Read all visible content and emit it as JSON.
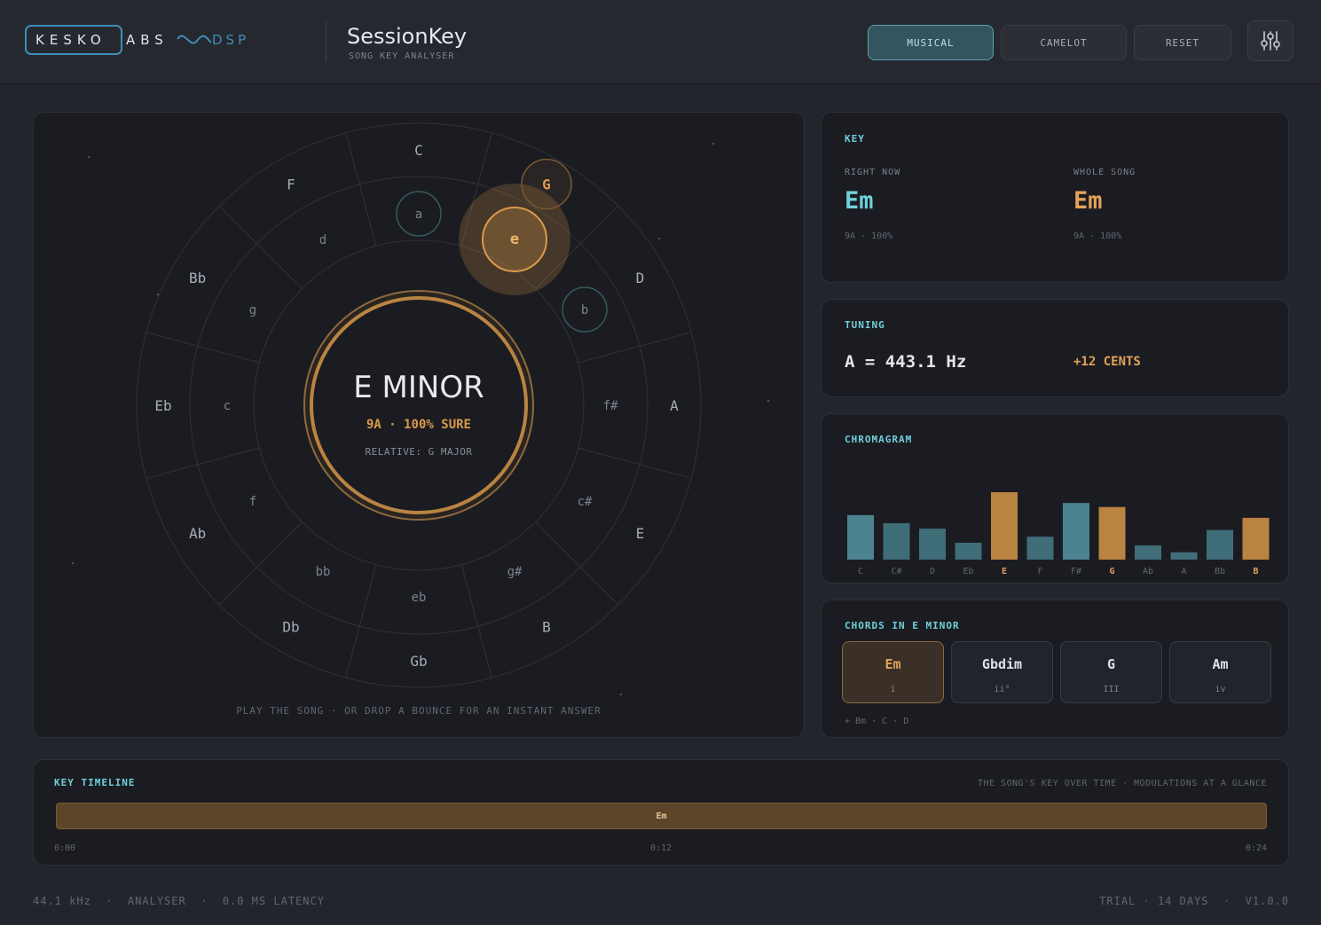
{
  "header": {
    "logo": {
      "brand_left": "KESKO",
      "brand_right": "ABS",
      "suffix": "DSP"
    },
    "title": "SessionKey",
    "subtitle": "SONG KEY ANALYSER",
    "modes": [
      {
        "label": "MUSICAL",
        "active": true
      },
      {
        "label": "CAMELOT",
        "active": false
      }
    ],
    "reset_label": "RESET",
    "settings_icon": "sliders-icon"
  },
  "wheel": {
    "major_keys": [
      "C",
      "G",
      "D",
      "A",
      "E",
      "B",
      "Gb",
      "Db",
      "Ab",
      "Eb",
      "Bb",
      "F"
    ],
    "minor_keys": [
      "a",
      "e",
      "b",
      "f#",
      "c#",
      "g#",
      "eb",
      "bb",
      "f",
      "c",
      "g",
      "d"
    ],
    "current_index": 1,
    "current_ring": "minor",
    "secondary_minor": [
      "a",
      "b"
    ],
    "secondary_major": [
      "G"
    ],
    "center": {
      "name": "E MINOR",
      "sure": "9A · 100% SURE",
      "relative": "RELATIVE: G MAJOR"
    },
    "hint": "PLAY THE SONG · OR DROP A BOUNCE FOR AN INSTANT ANSWER",
    "accent": "#d99a4b"
  },
  "key_panel": {
    "title": "KEY",
    "right_now": {
      "label": "RIGHT NOW",
      "value": "Em",
      "sub": "9A · 100%",
      "color": "#6fd0dc"
    },
    "whole_song": {
      "label": "WHOLE SONG",
      "value": "Em",
      "sub": "9A · 100%",
      "color": "#e2a15a"
    }
  },
  "tuning_panel": {
    "title": "TUNING",
    "value": "A = 443.1 Hz",
    "cents": "+12 CENTS"
  },
  "chromagram": {
    "title": "CHROMAGRAM",
    "notes": [
      "C",
      "C#",
      "D",
      "Eb",
      "E",
      "F",
      "F#",
      "G",
      "Ab",
      "A",
      "Bb",
      "B"
    ],
    "levels": [
      0.66,
      0.54,
      0.46,
      0.25,
      1.0,
      0.34,
      0.84,
      0.78,
      0.21,
      0.11,
      0.44,
      0.62
    ],
    "in_key": [
      false,
      false,
      false,
      false,
      true,
      false,
      false,
      true,
      false,
      false,
      false,
      true
    ],
    "colors": {
      "normal": "#3f6d78",
      "highlight": "#4b8490",
      "key": "#b98342"
    }
  },
  "chords_panel": {
    "title": "CHORDS IN E MINOR",
    "chords": [
      {
        "name": "Em",
        "degree": "i",
        "active": true
      },
      {
        "name": "Gbdim",
        "degree": "ii°",
        "active": false
      },
      {
        "name": "G",
        "degree": "III",
        "active": false
      },
      {
        "name": "Am",
        "degree": "iv",
        "active": false
      }
    ],
    "more": "+ Bm · C · D"
  },
  "timeline": {
    "title": "KEY TIMELINE",
    "caption": "THE SONG'S KEY OVER TIME · MODULATIONS AT A GLANCE",
    "segment_label": "Em",
    "times": [
      "0:00",
      "0:12",
      "0:24"
    ]
  },
  "footer": {
    "left": "44.1 kHz  ·  ANALYSER  ·  0.0 MS LATENCY",
    "right": "TRIAL · 14 DAYS  ·  V1.0.0"
  }
}
